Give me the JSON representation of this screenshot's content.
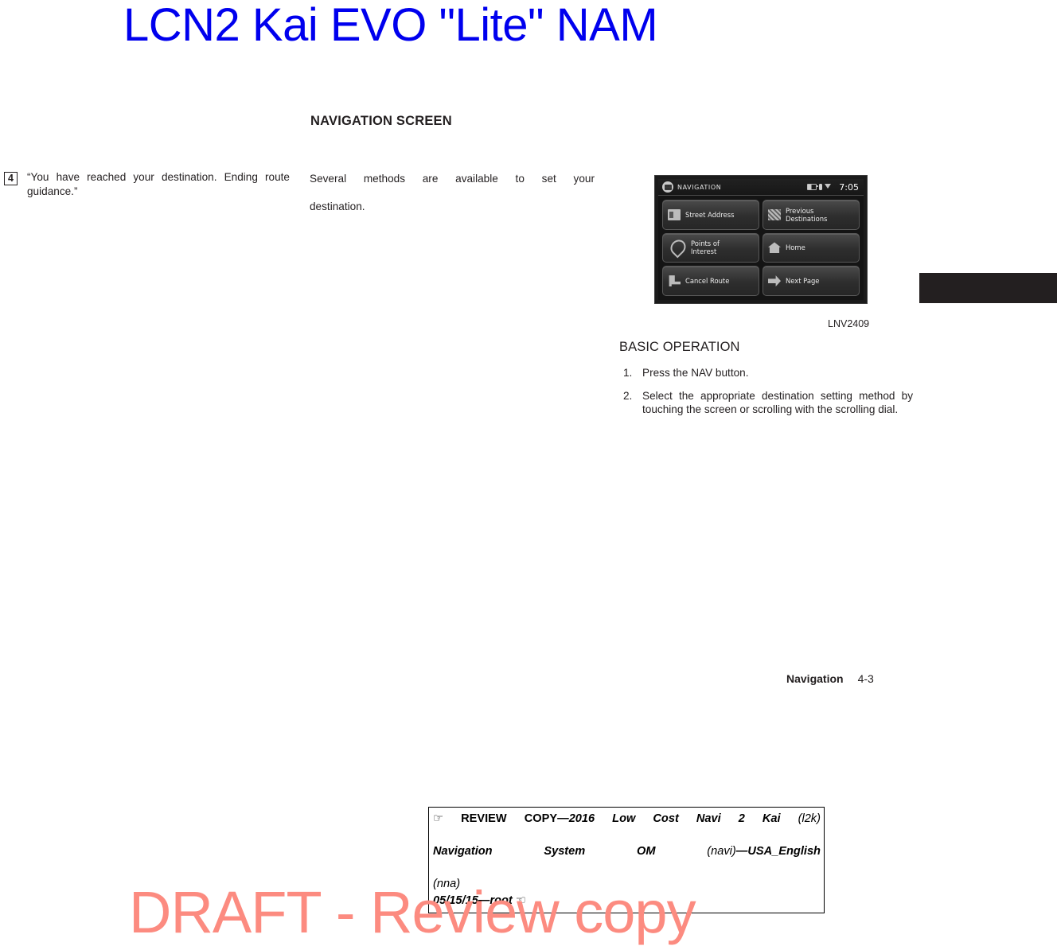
{
  "document": {
    "header_title": "LCN2 Kai EVO \"Lite\" NAM",
    "section_heading": "NAVIGATION SCREEN",
    "watermark": "DRAFT - Review copy"
  },
  "left_column": {
    "step_number": "4",
    "step_text": "“You have reached your destination. Ending route guidance.”"
  },
  "middle_column": {
    "paragraph_line1": "Several methods are available to set your",
    "paragraph_line2": "destination."
  },
  "right_column": {
    "photo_caption": "LNV2409",
    "sub_heading": "BASIC OPERATION",
    "steps": [
      {
        "num": "1.",
        "text": "Press the NAV button."
      },
      {
        "num": "2.",
        "text": "Select the appropriate destination setting method by touching the screen or scrolling with the scrolling dial."
      }
    ]
  },
  "nav_screen": {
    "status": {
      "title": "NAVIGATION",
      "time": "7:05",
      "icons": [
        "battery-icon",
        "phone-icon",
        "signal-icon"
      ]
    },
    "buttons": [
      {
        "label": "Street Address",
        "icon": "street-address-icon"
      },
      {
        "label": "Previous\nDestinations",
        "icon": "previous-destinations-icon"
      },
      {
        "label": "Points of\nInterest",
        "icon": "points-of-interest-icon"
      },
      {
        "label": "Home",
        "icon": "home-icon"
      },
      {
        "label": "Cancel Route",
        "icon": "cancel-route-icon"
      },
      {
        "label": "Next Page",
        "icon": "next-page-icon"
      }
    ]
  },
  "footer": {
    "label": "Navigation",
    "page": "4-3"
  },
  "review_box": {
    "line1_prefix": "REVIEW COPY—",
    "line1_title": "2016 Low Cost Navi 2 Kai",
    "line1_code": "(l2k)",
    "line2_a": "Navigation",
    "line2_b": "System",
    "line2_c": "OM",
    "line2_d": "(navi)",
    "line2_e": "—USA_English",
    "line3": "(nna)",
    "line4": "05/15/15—root"
  },
  "colors": {
    "header_blue": "#0000ee",
    "watermark_red": "#fc8b80",
    "body_black": "#231f20"
  }
}
